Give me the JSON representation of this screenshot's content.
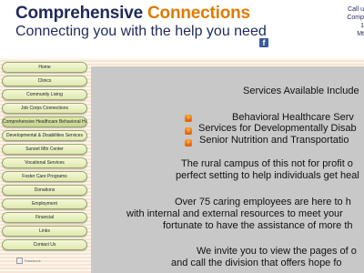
{
  "header": {
    "title_part1": "Comprehensive ",
    "title_part2": "Connections",
    "tagline": "Connecting you with the help you need",
    "facebook_icon": "f",
    "contact_lines": [
      "Call u",
      "Comp",
      "1",
      "Mt"
    ]
  },
  "nav": {
    "items": [
      "Home",
      "Clinics",
      "Community Living",
      "Job Corps Connections",
      "Comprehensive Healthcare Behavioral Health",
      "Developmental & Disabilities Services",
      "Sunset Mtn Center",
      "Vocational Services",
      "Foster Care Programs",
      "Donations",
      "Employment",
      "Financial",
      "Links",
      "Contact Us"
    ],
    "broken_image_alt": "Facebook"
  },
  "main": {
    "services_heading": "Services Available Include",
    "services": [
      "Behavioral Healthcare Serv",
      "Services for Developmentally Disab",
      "Senior Nutrition and Transportatio"
    ],
    "para1_line1": "The rural campus of this not for profit o",
    "para1_line2": "perfect setting to help individuals get heal",
    "para2_line1": "Over 75 caring employees are here to h",
    "para2_line2": "with internal and external resources to meet your",
    "para2_line3": "fortunate to have the assistance of more th",
    "para3_line1": "We invite you to view the pages of o",
    "para3_line2": "and call the division that offers hope fo"
  },
  "colors": {
    "brand_navy": "#1f2a5a",
    "brand_orange": "#e07b00",
    "content_bg": "#c8c8c8"
  }
}
